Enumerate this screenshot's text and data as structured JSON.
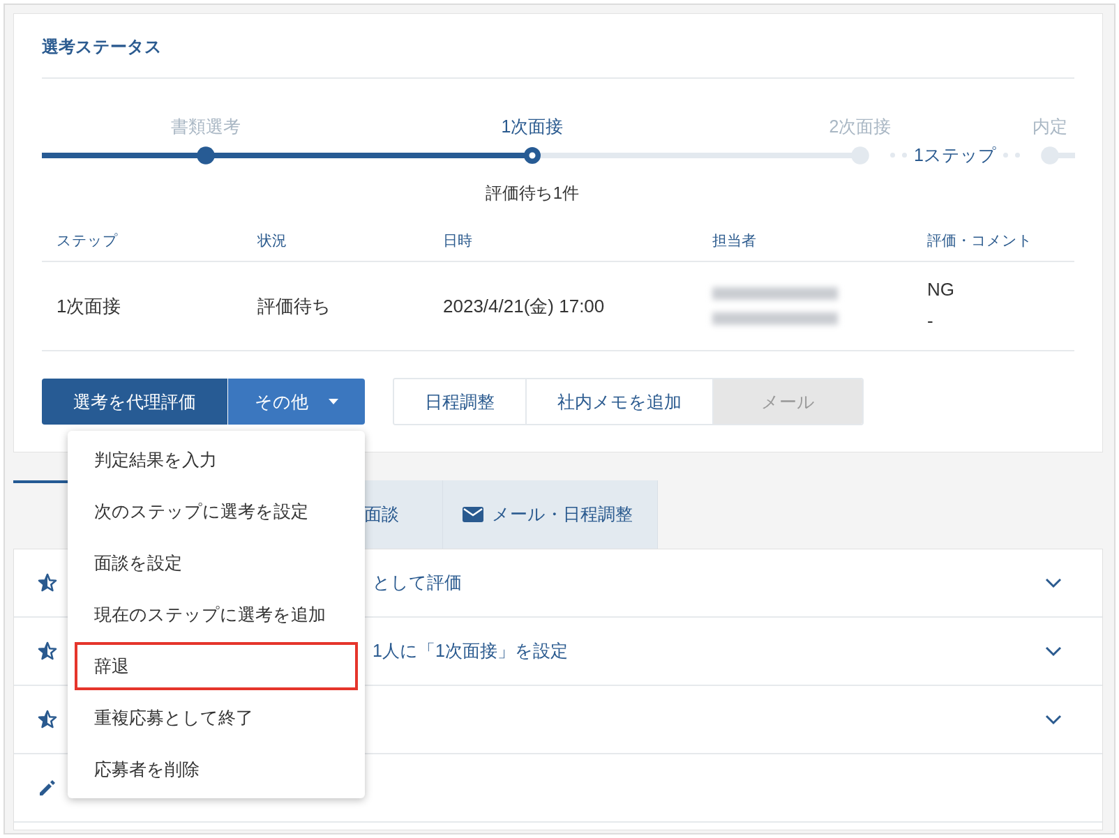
{
  "section": {
    "title": "選考ステータス"
  },
  "steps": [
    {
      "label": "書類選考",
      "completed": true,
      "selected": false
    },
    {
      "label": "1次面接",
      "completed": false,
      "selected": true
    },
    {
      "label": "2次面接",
      "completed": false,
      "selected": false
    },
    {
      "label": "内定",
      "completed": false,
      "selected": false
    }
  ],
  "skip_note": "1ステップ",
  "pending_note": "評価待ち1件",
  "table": {
    "columns": [
      "ステップ",
      "状況",
      "日時",
      "担当者",
      "評価・コメント"
    ],
    "rows": [
      {
        "step": "1次面接",
        "status": "評価待ち",
        "datetime": "2023/4/21(金) 17:00",
        "evaluation": "NG",
        "comment": "-"
      }
    ]
  },
  "primary_button": "選考を代理評価",
  "more_button": {
    "label": "その他",
    "expanded": true
  },
  "actions": [
    {
      "label": "日程調整",
      "disabled": false
    },
    {
      "label": "社内メモを追加",
      "disabled": false
    },
    {
      "label": "メール",
      "disabled": true
    }
  ],
  "menu": {
    "items": [
      {
        "label": "判定結果を入力",
        "highlighted": false
      },
      {
        "label": "次のステップに選考を設定",
        "highlighted": false
      },
      {
        "label": "面談を設定",
        "highlighted": false
      },
      {
        "label": "現在のステップに選考を追加",
        "highlighted": false
      },
      {
        "label": "辞退",
        "highlighted": true
      },
      {
        "label": "重複応募として終了",
        "highlighted": false
      },
      {
        "label": "応募者を削除",
        "highlighted": false
      }
    ]
  },
  "tabs": [
    {
      "kind": "hidden",
      "selected": true
    },
    {
      "kind": "text",
      "label": "面談",
      "selected": false
    },
    {
      "kind": "mail",
      "label": "メール・日程調整",
      "selected": false
    }
  ],
  "timeline": [
    {
      "kind": "star",
      "text": "として評価",
      "expandable": true
    },
    {
      "kind": "star",
      "text": "1人に「1次面接」を設定",
      "expandable": true
    },
    {
      "kind": "star",
      "expandable": true
    },
    {
      "kind": "edit",
      "expandable": false
    }
  ]
}
